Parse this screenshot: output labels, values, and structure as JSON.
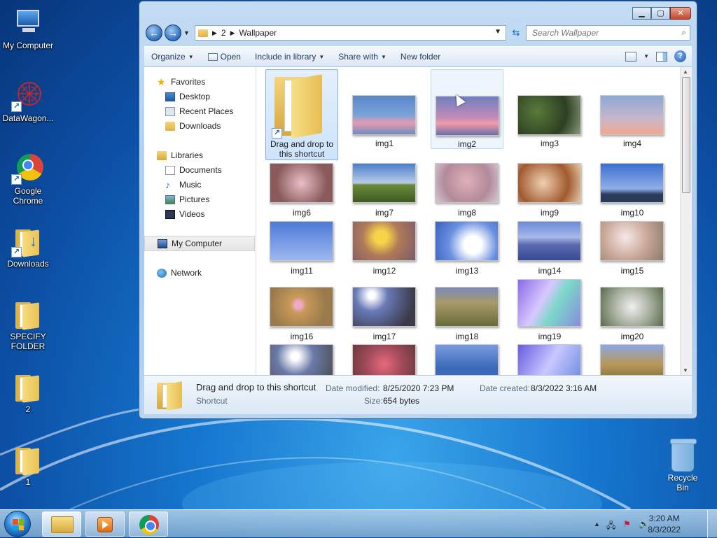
{
  "desktop": {
    "icons": [
      {
        "label": "My Computer",
        "icon": "computer-icon"
      },
      {
        "label": "DataWagon...",
        "icon": "datawagon-icon"
      },
      {
        "label": "Google Chrome",
        "icon": "chrome-icon"
      },
      {
        "label": "Downloads",
        "icon": "downloads-folder-icon"
      },
      {
        "label": "SPECIFY FOLDER",
        "icon": "folder-icon"
      },
      {
        "label": "2",
        "icon": "folder-icon"
      },
      {
        "label": "1",
        "icon": "folder-icon"
      }
    ],
    "recycle_bin": {
      "label": "Recycle Bin"
    }
  },
  "explorer": {
    "caption": {
      "minimize": "▁",
      "maximize": "▢",
      "close": "✕"
    },
    "address": {
      "crumbs": [
        "2",
        "Wallpaper"
      ]
    },
    "search": {
      "placeholder": "Search Wallpaper"
    },
    "toolbar": {
      "organize": "Organize",
      "open": "Open",
      "include": "Include in library",
      "share": "Share with",
      "new_folder": "New folder"
    },
    "nav": {
      "favorites": "Favorites",
      "desktop": "Desktop",
      "recent": "Recent Places",
      "downloads": "Downloads",
      "libraries": "Libraries",
      "documents": "Documents",
      "music": "Music",
      "pictures": "Pictures",
      "videos": "Videos",
      "computer": "My Computer",
      "network": "Network"
    },
    "files": {
      "shortcut": "Drag and drop to this shortcut",
      "row1": [
        "img1",
        "img2",
        "img3",
        "img4"
      ],
      "row2": [
        "img6",
        "img7",
        "img8",
        "img9",
        "img10"
      ],
      "row3": [
        "img11",
        "img12",
        "img13",
        "img14",
        "img15"
      ],
      "row4": [
        "img16",
        "img17",
        "img18",
        "img19",
        "img20"
      ]
    },
    "details": {
      "name": "Drag and drop to this shortcut",
      "type": "Shortcut",
      "date_modified_label": "Date modified:",
      "date_modified": "8/25/2020 7:23 PM",
      "date_created_label": "Date created:",
      "date_created": "8/3/2022 3:16 AM",
      "size_label": "Size:",
      "size": "654 bytes"
    }
  },
  "taskbar": {
    "time": "3:20 AM",
    "date": "8/3/2022"
  },
  "colors": {
    "selection": "#cde4fb",
    "accent": "#1c6ac1"
  }
}
